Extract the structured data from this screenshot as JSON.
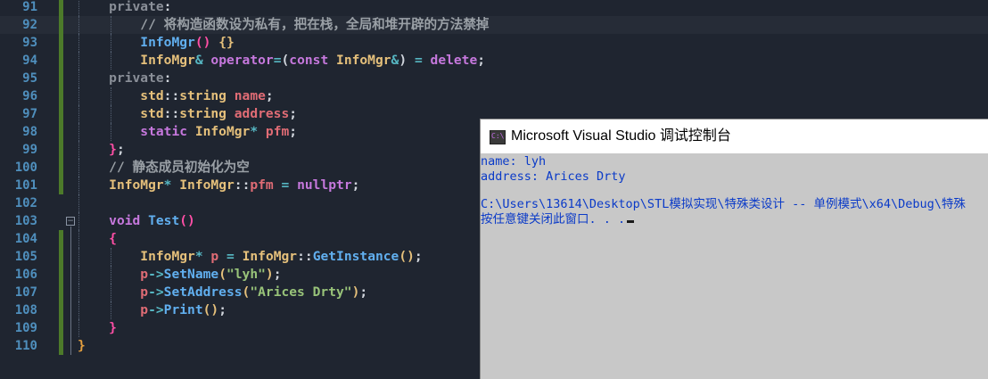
{
  "editor": {
    "lines": [
      {
        "num": "91"
      },
      {
        "num": "92"
      },
      {
        "num": "93"
      },
      {
        "num": "94"
      },
      {
        "num": "95"
      },
      {
        "num": "96"
      },
      {
        "num": "97"
      },
      {
        "num": "98"
      },
      {
        "num": "99"
      },
      {
        "num": "100"
      },
      {
        "num": "101"
      },
      {
        "num": "102"
      },
      {
        "num": "103"
      },
      {
        "num": "104"
      },
      {
        "num": "105"
      },
      {
        "num": "106"
      },
      {
        "num": "107"
      },
      {
        "num": "108"
      },
      {
        "num": "109"
      },
      {
        "num": "110"
      }
    ],
    "fold_icon": "minus-box",
    "colors": {
      "background": "#1f2530",
      "line_number": "#4f8fbd",
      "change_bar": "#4c7a2a"
    }
  },
  "console": {
    "icon": "console-app-icon",
    "title": "Microsoft Visual Studio 调试控制台",
    "output": [
      "name: lyh",
      "address: Arices Drty",
      "",
      "C:\\Users\\13614\\Desktop\\STL模拟实现\\特殊类设计 -- 单例模式\\x64\\Debug\\特殊",
      "按任意键关闭此窗口. . ."
    ],
    "colors": {
      "text": "#0a3ac8",
      "background": "#c8c8c8"
    }
  }
}
